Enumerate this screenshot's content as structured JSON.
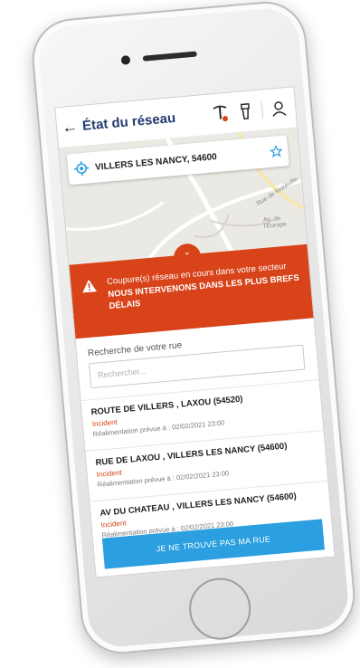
{
  "app": {
    "title": "État du réseau",
    "back_label": "←"
  },
  "header_actions": [
    {
      "name": "tools-icon",
      "accent": "#d8431a"
    },
    {
      "name": "flashlight-icon"
    },
    {
      "name": "user-icon"
    }
  ],
  "location": {
    "value": "VILLERS LES NANCY, 54600",
    "icons": {
      "left": "locate-icon",
      "right": "star-icon"
    }
  },
  "map": {
    "labels": [
      "Rue de Maréville",
      "Av. de l'Europe"
    ]
  },
  "alert": {
    "chevron": "⌄",
    "line1": "Coupure(s) réseau en cours dans votre secteur",
    "line2": "NOUS INTERVENONS DANS LES PLUS BREFS DÉLAIS",
    "color": "#d8431a"
  },
  "search": {
    "label": "Recherche de votre rue",
    "placeholder": "Rechercher...",
    "value": ""
  },
  "streets": [
    {
      "name": "ROUTE DE VILLERS , LAXOU (54520)",
      "status": "Incident",
      "eta": "Réalimentation prévue à : 02/02/2021 23:00"
    },
    {
      "name": "RUE DE LAXOU , VILLERS LES NANCY (54600)",
      "status": "Incident",
      "eta": "Réalimentation prévue à : 02/02/2021 23:00"
    },
    {
      "name": "AV DU CHATEAU , VILLERS LES NANCY (54600)",
      "status": "Incident",
      "eta": "Réalimentation prévue à : 02/02/2021 23:00"
    }
  ],
  "cta": {
    "label": "JE NE TROUVE PAS MA RUE",
    "color": "#2b9fe0"
  },
  "colors": {
    "title": "#233a6f",
    "accent": "#d8431a",
    "button": "#2b9fe0"
  }
}
